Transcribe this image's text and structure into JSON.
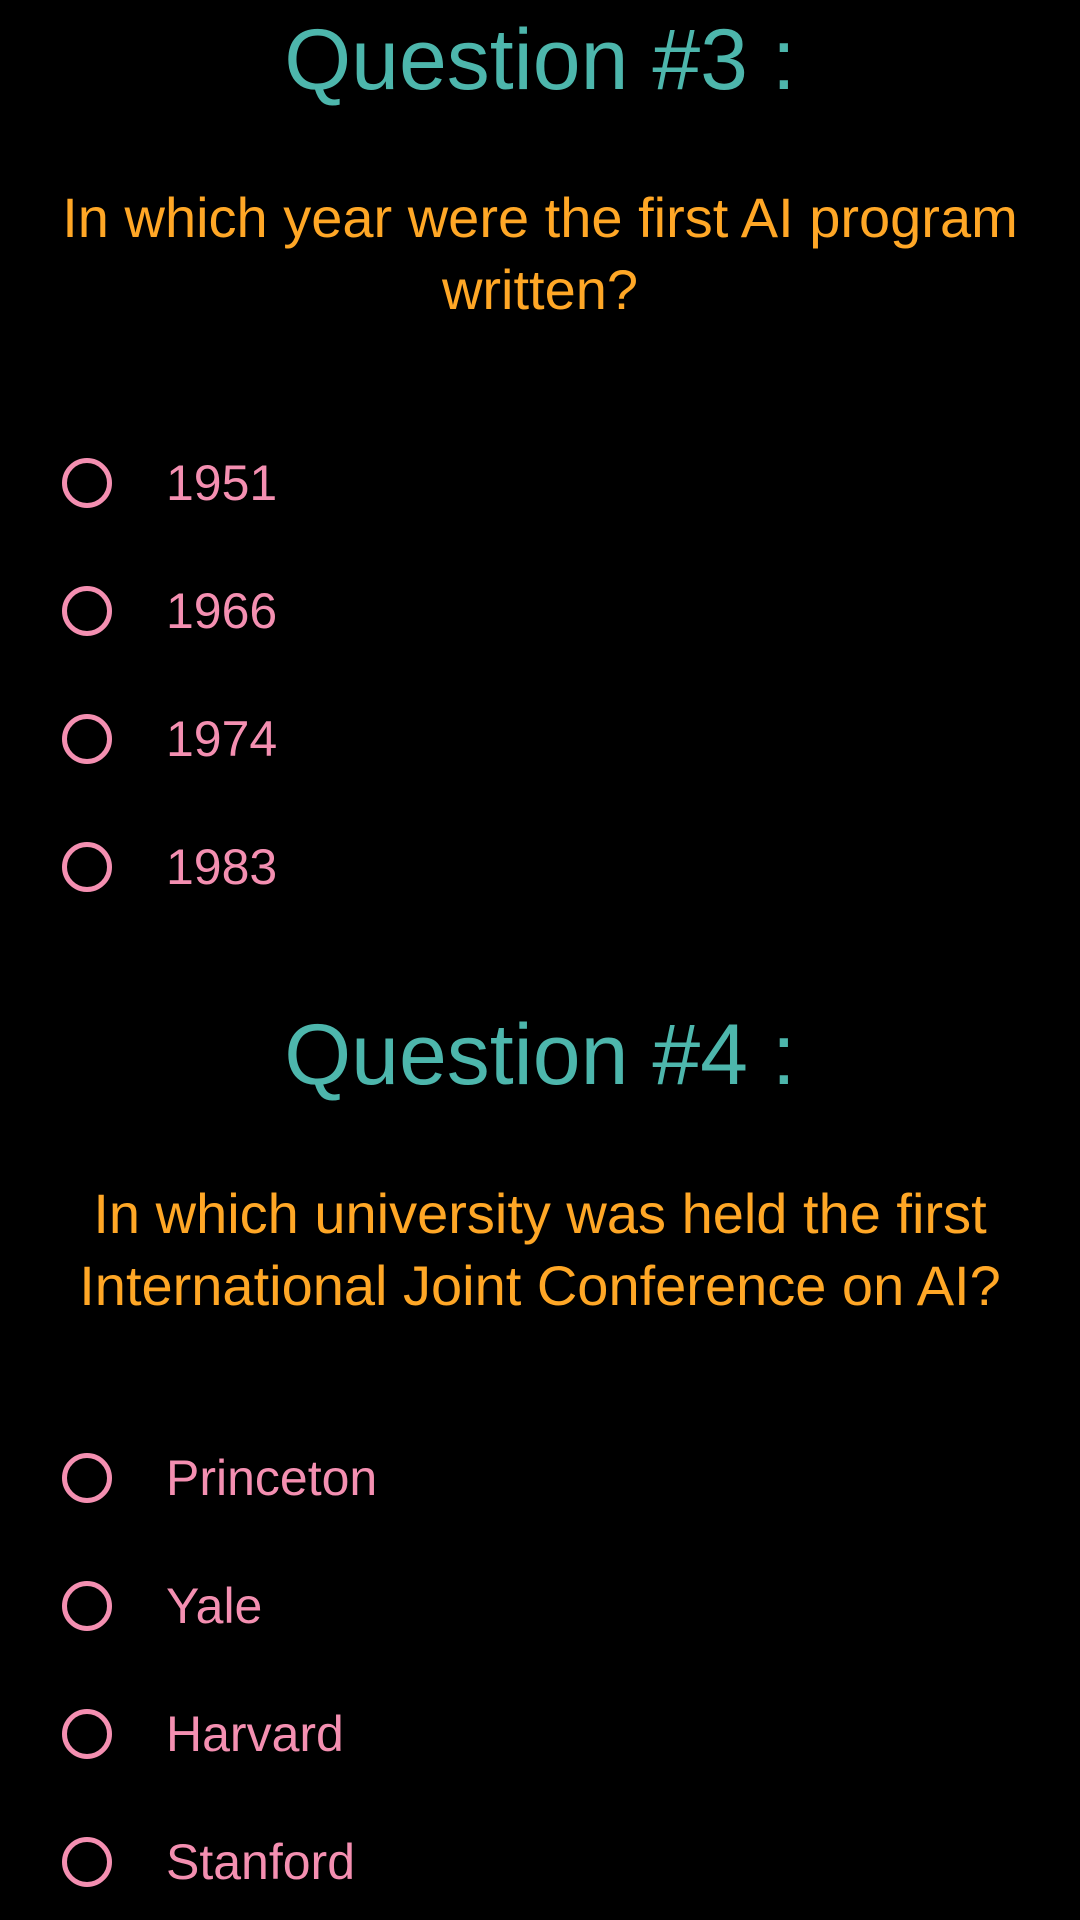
{
  "questions": [
    {
      "title": "Question #3 :",
      "text": "In which year were the first AI program written?",
      "options": [
        {
          "label": "1951"
        },
        {
          "label": "1966"
        },
        {
          "label": "1974"
        },
        {
          "label": "1983"
        }
      ]
    },
    {
      "title": "Question #4 :",
      "text": "In which university was held the first International Joint Conference on AI?",
      "options": [
        {
          "label": "Princeton"
        },
        {
          "label": "Yale"
        },
        {
          "label": "Harvard"
        },
        {
          "label": "Stanford"
        }
      ]
    }
  ],
  "colors": {
    "background": "#000000",
    "title": "#4db6ac",
    "question_text": "#ffa726",
    "option": "#f48fb1"
  },
  "icons": {
    "radio": "radio-unchecked-icon"
  }
}
